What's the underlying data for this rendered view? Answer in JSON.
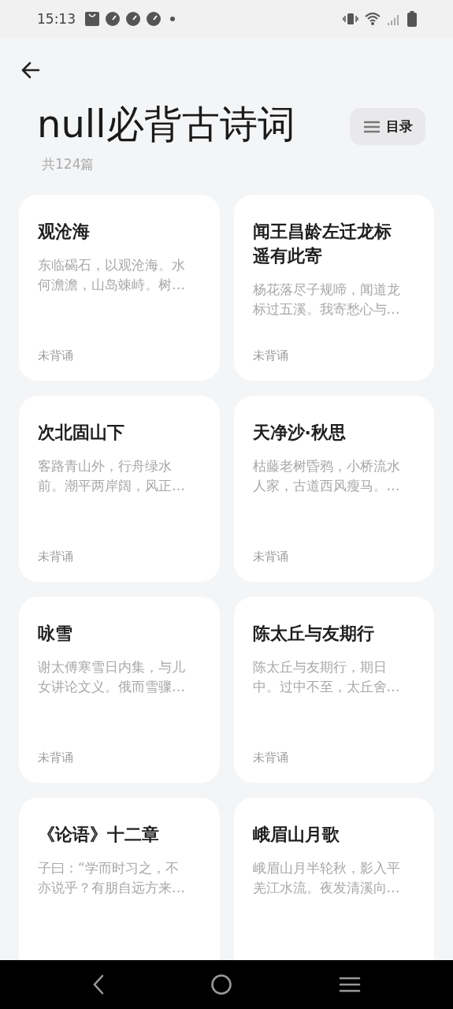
{
  "status_bar": {
    "time": "15:13"
  },
  "header": {
    "title": "null必背古诗词",
    "count": "共124篇",
    "menu_button": "目录"
  },
  "poems": [
    {
      "title": "观沧海",
      "excerpt": "东临碣石，以观沧海。水何澹澹，山岛竦峙。树…",
      "status": "未背诵"
    },
    {
      "title": "闻王昌龄左迁龙标遥有此寄",
      "excerpt": "杨花落尽子规啼，闻道龙标过五溪。我寄愁心与…",
      "status": "未背诵"
    },
    {
      "title": "次北固山下",
      "excerpt": "客路青山外，行舟绿水前。潮平两岸阔，风正…",
      "status": "未背诵"
    },
    {
      "title": "天净沙·秋思",
      "excerpt": "枯藤老树昏鸦，小桥流水人家，古道西风瘦马。…",
      "status": "未背诵"
    },
    {
      "title": "咏雪",
      "excerpt": "谢太傅寒雪日内集，与儿女讲论文义。俄而雪骤…",
      "status": "未背诵"
    },
    {
      "title": "陈太丘与友期行",
      "excerpt": "陈太丘与友期行，期日中。过中不至，太丘舍…",
      "status": "未背诵"
    },
    {
      "title": "《论语》十二章",
      "excerpt": "子曰：“学而时习之，不亦说乎？有朋自远方来…"
    },
    {
      "title": "峨眉山月歌",
      "excerpt": "峨眉山月半轮秋，影入平羌江水流。夜发清溪向…"
    }
  ]
}
